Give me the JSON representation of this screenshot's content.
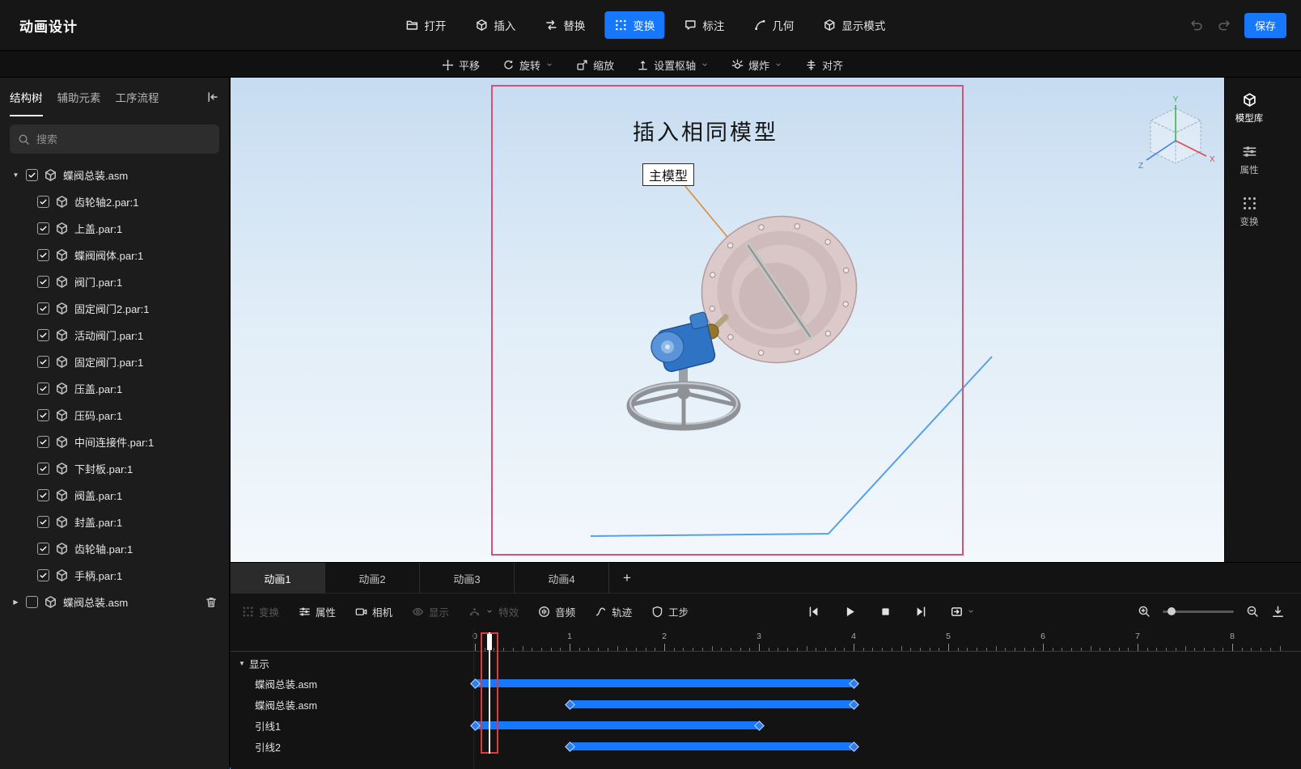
{
  "app": {
    "title": "动画设计",
    "save_label": "保存"
  },
  "topbar": {
    "items": [
      {
        "id": "open",
        "label": "打开",
        "icon": "open-icon",
        "active": false
      },
      {
        "id": "insert",
        "label": "插入",
        "icon": "insert-icon",
        "active": false
      },
      {
        "id": "replace",
        "label": "替换",
        "icon": "replace-icon",
        "active": false
      },
      {
        "id": "transform",
        "label": "变换",
        "icon": "transform-icon",
        "active": true
      },
      {
        "id": "annotate",
        "label": "标注",
        "icon": "annotate-icon",
        "active": false
      },
      {
        "id": "geometry",
        "label": "几何",
        "icon": "geometry-icon",
        "active": false
      },
      {
        "id": "display-mode",
        "label": "显示模式",
        "icon": "display-mode-icon",
        "active": false
      }
    ]
  },
  "transform_toolbar": {
    "items": [
      {
        "id": "pan",
        "label": "平移",
        "icon": "pan-icon",
        "dropdown": false
      },
      {
        "id": "rotate",
        "label": "旋转",
        "icon": "rotate-icon",
        "dropdown": true
      },
      {
        "id": "scale",
        "label": "缩放",
        "icon": "scale-icon",
        "dropdown": false
      },
      {
        "id": "pivot",
        "label": "设置枢轴",
        "icon": "pivot-icon",
        "dropdown": true
      },
      {
        "id": "explode",
        "label": "爆炸",
        "icon": "explode-icon",
        "dropdown": true
      },
      {
        "id": "align",
        "label": "对齐",
        "icon": "align-icon",
        "dropdown": false
      }
    ]
  },
  "sidebar": {
    "tabs": [
      {
        "id": "structure-tree",
        "label": "结构树",
        "active": true
      },
      {
        "id": "aux-elements",
        "label": "辅助元素",
        "active": false
      },
      {
        "id": "process-flow",
        "label": "工序流程",
        "active": false
      }
    ],
    "search_placeholder": "搜索",
    "tree": {
      "root": {
        "label": "蝶阀总装.asm",
        "checked": true,
        "expanded": true
      },
      "children": [
        "齿轮轴2.par:1",
        "上盖.par:1",
        "蝶阀阀体.par:1",
        "阀门.par:1",
        "固定阀门2.par:1",
        "活动阀门.par:1",
        "固定阀门.par:1",
        "压盖.par:1",
        "压码.par:1",
        "中间连接件.par:1",
        "下封板.par:1",
        "阀盖.par:1",
        "封盖.par:1",
        "齿轮轴.par:1",
        "手柄.par:1"
      ],
      "root2": {
        "label": "蝶阀总装.asm",
        "checked": false,
        "expanded": false
      }
    }
  },
  "viewport": {
    "slide_title": "插入相同模型",
    "callout_label": "主模型",
    "view_cube_axes": {
      "x": "X",
      "y": "Y",
      "z": "Z"
    }
  },
  "right_panel": {
    "items": [
      {
        "id": "model-library",
        "label": "模型库",
        "icon": "model-library-icon",
        "active": true
      },
      {
        "id": "properties",
        "label": "属性",
        "icon": "properties-icon",
        "active": false
      },
      {
        "id": "transform",
        "label": "变换",
        "icon": "transform-panel-icon",
        "active": false
      }
    ]
  },
  "timeline": {
    "tabs": [
      {
        "label": "动画1",
        "active": true
      },
      {
        "label": "动画2",
        "active": false
      },
      {
        "label": "动画3",
        "active": false
      },
      {
        "label": "动画4",
        "active": false
      }
    ],
    "add_tab_label": "+",
    "tools": [
      {
        "id": "transform",
        "label": "变换",
        "icon": "transform-icon",
        "disabled": true,
        "dropdown": false
      },
      {
        "id": "properties",
        "label": "属性",
        "icon": "properties-icon",
        "disabled": false,
        "dropdown": false
      },
      {
        "id": "camera",
        "label": "相机",
        "icon": "camera-icon",
        "disabled": false,
        "dropdown": false
      },
      {
        "id": "display",
        "label": "显示",
        "icon": "display-icon",
        "disabled": true,
        "dropdown": false
      },
      {
        "id": "effects",
        "label": "特效",
        "icon": "effects-icon",
        "disabled": true,
        "dropdown": true
      },
      {
        "id": "audio",
        "label": "音频",
        "icon": "audio-icon",
        "disabled": false,
        "dropdown": false
      },
      {
        "id": "trajectory",
        "label": "轨迹",
        "icon": "trajectory-icon",
        "disabled": false,
        "dropdown": false
      },
      {
        "id": "step",
        "label": "工步",
        "icon": "step-icon",
        "disabled": false,
        "dropdown": false
      }
    ],
    "group_label": "显示",
    "ruler": {
      "start": 0,
      "end": 8
    },
    "playhead_time": 0.15,
    "tracks": [
      {
        "label": "蝶阀总装.asm",
        "start": 0,
        "end": 4,
        "keys": [
          0,
          4
        ]
      },
      {
        "label": "蝶阀总装.asm",
        "start": 1,
        "end": 4,
        "keys": [
          1,
          4
        ]
      },
      {
        "label": "引线1",
        "start": 0,
        "end": 3,
        "keys": [
          0,
          3
        ]
      },
      {
        "label": "引线2",
        "start": 1,
        "end": 4,
        "keys": [
          1,
          4
        ]
      }
    ]
  },
  "colors": {
    "accent": "#1677ff",
    "slide_border": "#d6527b",
    "leader_orange": "#e0893c",
    "leader_blue": "#58a0e4",
    "bar": "#1677ff",
    "playhead_red": "#e23a3a"
  }
}
